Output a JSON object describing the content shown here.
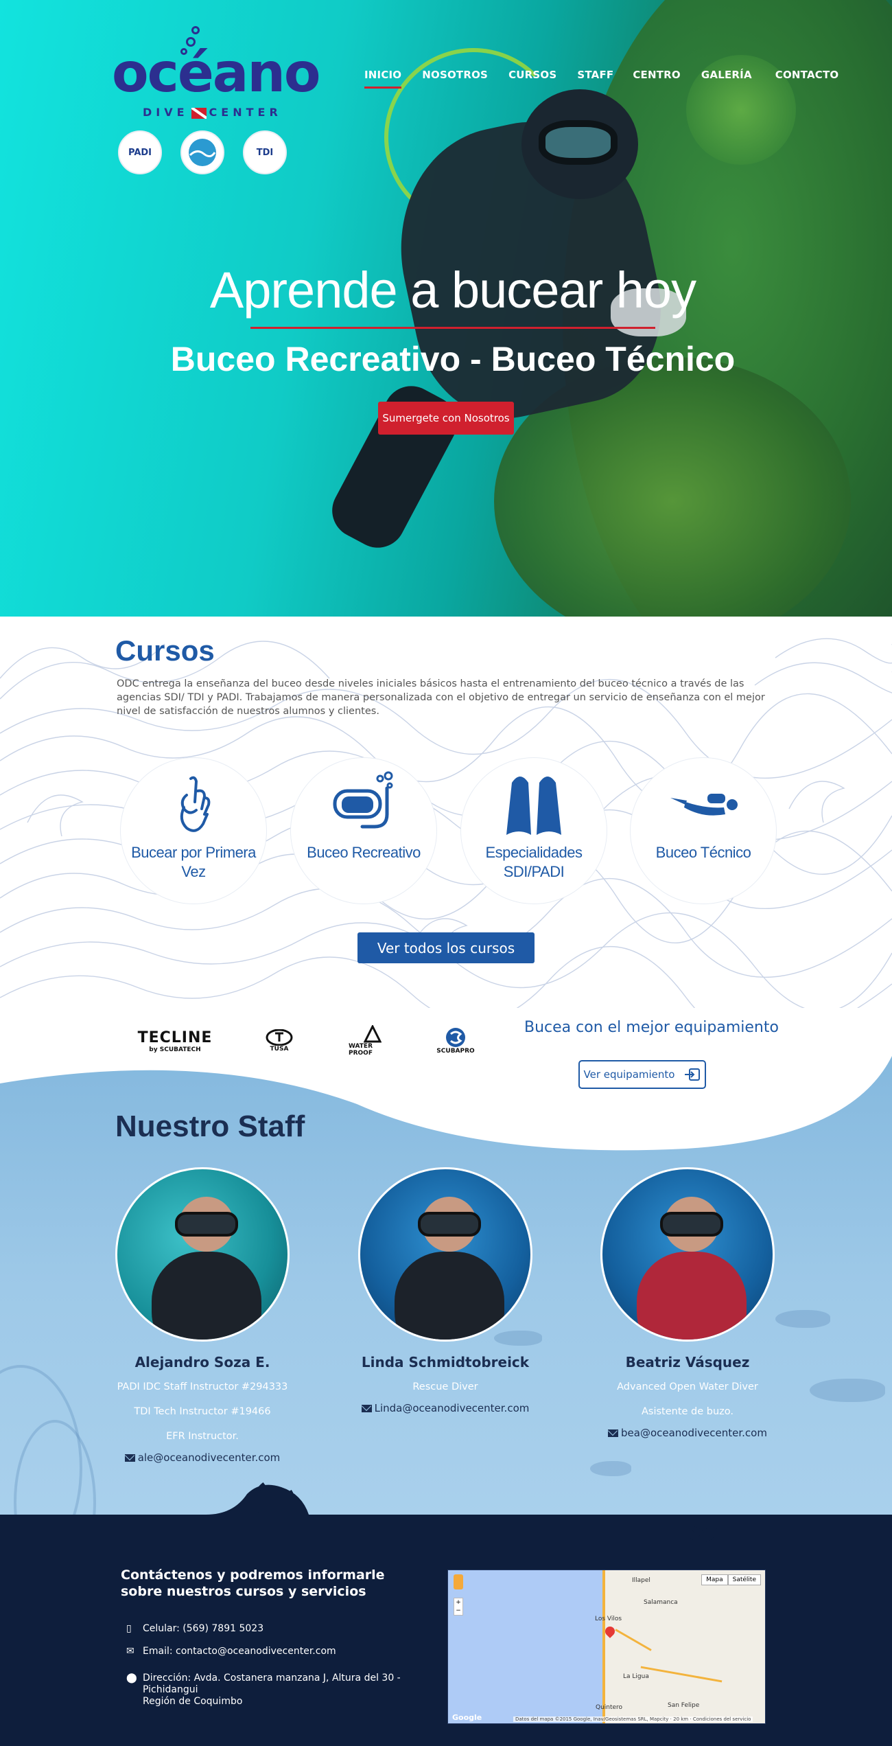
{
  "brand": {
    "logo_word": "océano",
    "logo_sub_left": "DIVE",
    "logo_sub_right": "CENTER"
  },
  "agencies": [
    {
      "label": "PADI",
      "icon": "padi-badge-icon"
    },
    {
      "label": "",
      "icon": "scuba-diving-international-badge-icon"
    },
    {
      "label": "TDI",
      "icon": "tdi-badge-icon"
    }
  ],
  "nav": {
    "items": [
      "INICIO",
      "NOSOTROS",
      "CURSOS",
      "STAFF",
      "CENTRO",
      "GALERÍA",
      "CONTACTO"
    ],
    "active": "INICIO"
  },
  "hero": {
    "title": "Aprende a bucear hoy",
    "subtitle": "Buceo Recreativo - Buceo Técnico",
    "button": "Sumergete con Nosotros"
  },
  "cursos": {
    "title": "Cursos",
    "text": "ODC entrega la enseñanza del buceo desde niveles iniciales básicos hasta el entrenamiento del buceo técnico a través de las agencias SDI/ TDI y PADI. Trabajamos de manera personalizada con el objetivo de entregar un servicio de enseñanza con el mejor nivel de satisfacción de nuestros alumnos y clientes.",
    "items": [
      {
        "label": "Bucear por Primera Vez",
        "icon": "ok-hand-icon"
      },
      {
        "label": "Buceo Recreativo",
        "icon": "diving-mask-icon"
      },
      {
        "label": "Especialidades SDI/PADI",
        "icon": "fins-icon"
      },
      {
        "label": "Buceo Técnico",
        "icon": "diver-icon"
      }
    ],
    "button": "Ver todos los cursos"
  },
  "equipment": {
    "brands": [
      {
        "name": "TECLINE",
        "sub": "by SCUBATECH"
      },
      {
        "name": "TUSA",
        "sub": ""
      },
      {
        "name": "WATER PROOF",
        "sub": ""
      },
      {
        "name": "SCUBAPRO",
        "sub": ""
      }
    ],
    "text": "Bucea con el mejor equipamiento",
    "button": "Ver equipamiento"
  },
  "staff": {
    "title": "Nuestro Staff",
    "members": [
      {
        "name": "Alejandro Soza E.",
        "lines": [
          "PADI IDC Staff Instructor #294333",
          "TDI Tech Instructor #19466",
          "EFR Instructor."
        ],
        "email": "ale@oceanodivecenter.com"
      },
      {
        "name": "Linda Schmidtobreick",
        "lines": [
          "Rescue Diver"
        ],
        "email": "Linda@oceanodivecenter.com"
      },
      {
        "name": "Beatriz Vásquez",
        "lines": [
          "Advanced Open Water Diver",
          "Asistente de buzo."
        ],
        "email": "bea@oceanodivecenter.com"
      }
    ]
  },
  "social": [
    "twitter-icon",
    "facebook-icon"
  ],
  "footer": {
    "title": "Contáctenos y podremos informarle sobre nuestros cursos y servicios",
    "phone": "Celular: (569) 7891 5023",
    "email": "Email: contacto@oceanodivecenter.com",
    "address_1": "Dirección: Avda. Costanera manzana J, Altura del 30 - Pichidangui",
    "address_2": "Región de Coquimbo"
  },
  "map": {
    "type_map": "Mapa",
    "type_sat": "Satélite",
    "towns": [
      "Illapel",
      "Salamanca",
      "Los Vilos",
      "La Ligua",
      "Quintero",
      "San Felipe"
    ],
    "attribution": "Datos del mapa ©2015 Google, Inav/Geosistemas SRL, Mapcity",
    "scale": "20 km",
    "terms": "Condiciones del servicio",
    "google": "Google"
  },
  "colors": {
    "accent_red": "#d0202e",
    "brand_blue": "#1f5aa6",
    "navy": "#0e1e3c",
    "logo_purple": "#2c2f8f"
  }
}
